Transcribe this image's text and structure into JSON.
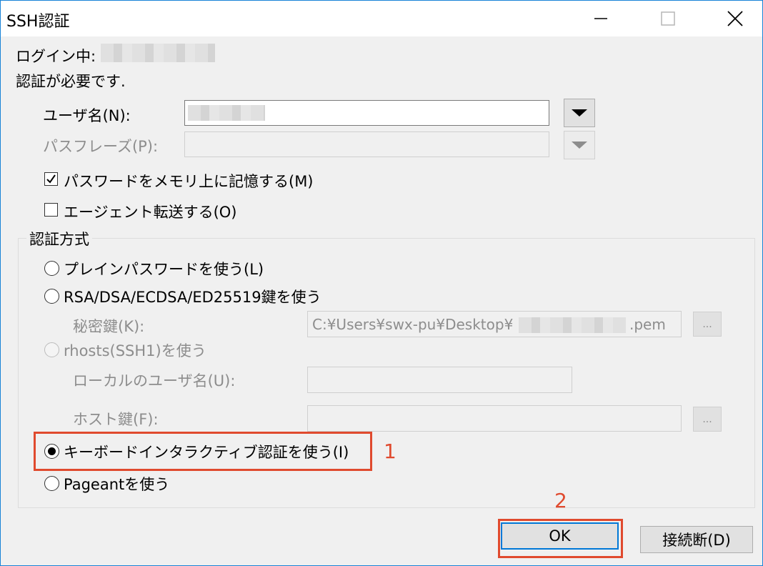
{
  "window": {
    "title": "SSH認証"
  },
  "login": {
    "label": "ログイン中:"
  },
  "auth_required": "認証が必要です.",
  "username": {
    "label": "ユーザ名(N):",
    "value": ""
  },
  "passphrase": {
    "label": "パスフレーズ(P):",
    "value": ""
  },
  "remember_password": {
    "label": "パスワードをメモリ上に記憶する(M)",
    "checked": true
  },
  "agent_forward": {
    "label": "エージェント転送する(O)",
    "checked": false
  },
  "auth_method": {
    "title": "認証方式",
    "plain_password": "プレインパスワードを使う(L)",
    "rsa": "RSA/DSA/ECDSA/ED25519鍵を使う",
    "private_key_label": "秘密鍵(K):",
    "private_key_value_prefix": "C:¥Users¥swx-pu¥Desktop¥",
    "private_key_value_suffix": ".pem",
    "rhosts": "rhosts(SSH1)を使う",
    "local_user_label": "ローカルのユーザ名(U):",
    "host_key_label": "ホスト鍵(F):",
    "browse_label": "...",
    "keyboard_interactive": "キーボードインタラクティブ認証を使う(I)",
    "pageant": "Pageantを使う",
    "selected": "keyboard_interactive"
  },
  "buttons": {
    "ok": "OK",
    "disconnect": "接続断(D)"
  },
  "annotations": {
    "step1": "1",
    "step2": "2",
    "color": "#e04a2e"
  }
}
